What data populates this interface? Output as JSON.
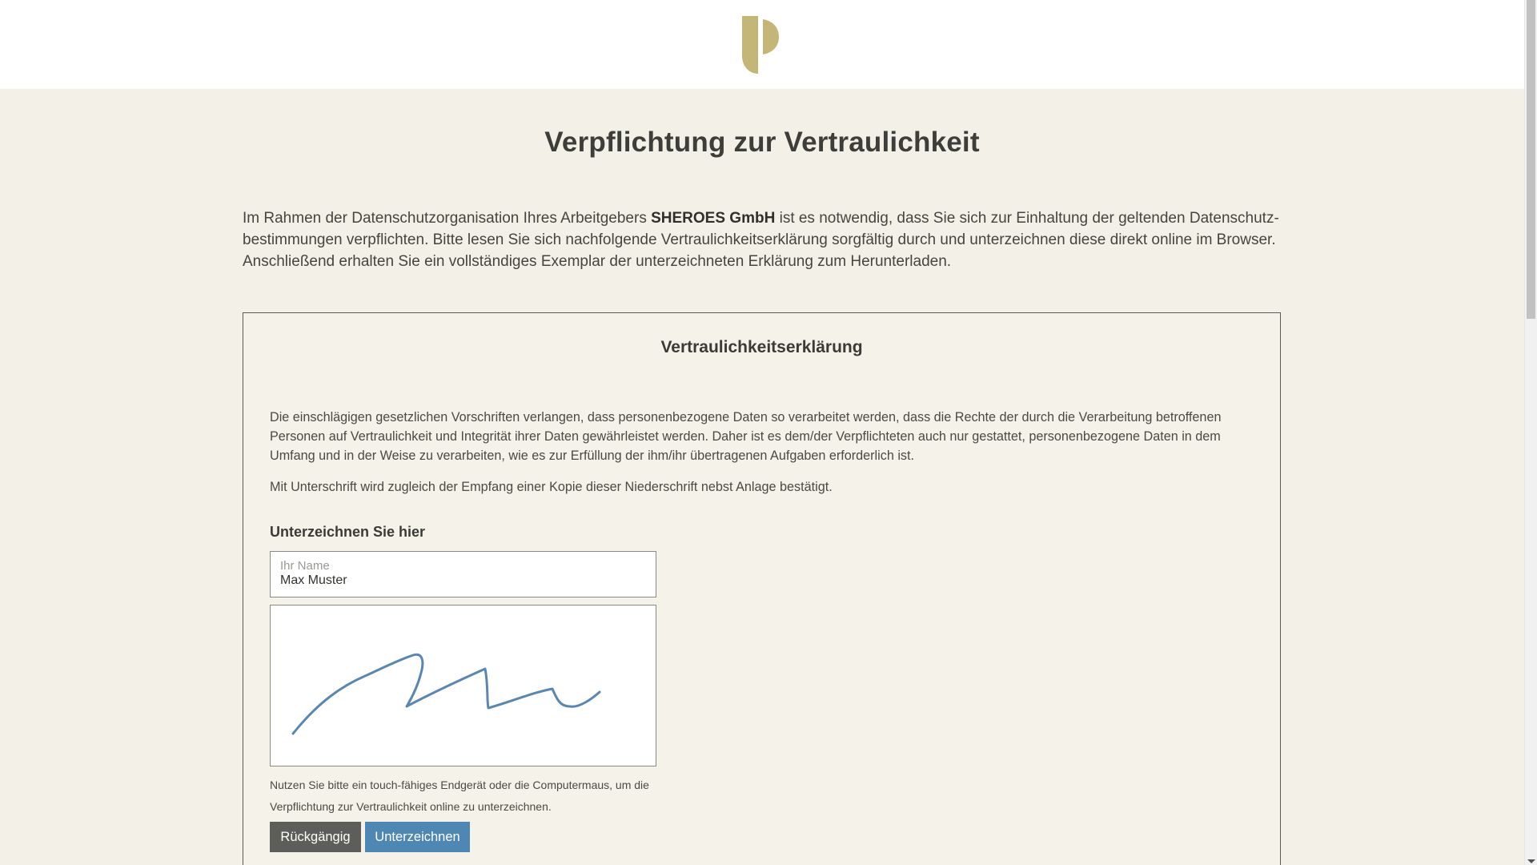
{
  "header": {
    "logo": "p-logo",
    "logo_color": "#c3b676"
  },
  "main": {
    "title": "Verpflichtung zur Vertraulichkeit",
    "intro_before": "Im Rahmen der Datenschutzorganisation Ihres Arbeitgebers ",
    "intro_company": "SHEROES GmbH",
    "intro_after": " ist es notwendig, dass Sie sich zur Einhaltung der geltenden Datenschutz-bestimmungen verpflichten. Bitte lesen Sie sich nachfolgende Vertraulichkeitserklärung sorgfältig durch und unterzeichnen diese direkt online im Browser. Anschließend erhalten Sie ein vollständiges Exemplar der unterzeichneten Erklärung zum Herunterladen."
  },
  "card": {
    "title": "Vertraulichkeitserklärung",
    "paragraph1": "Die einschlägigen gesetzlichen Vorschriften verlangen, dass personenbezogene Daten so verarbeitet werden, dass die Rechte der durch die Verarbeitung betroffenen Personen auf Vertraulichkeit und Integrität ihrer Daten gewährleistet werden. Daher ist es dem/der Verpflichteten auch nur gestattet, personenbezogene Daten in dem Umfang und in der Weise zu verarbeiten, wie es zur Erfüllung der ihm/ihr übertragenen Aufgaben erforderlich ist.",
    "paragraph2": "Mit Unterschrift wird zugleich der Empfang einer Kopie dieser Niederschrift nebst Anlage bestätigt."
  },
  "signature": {
    "heading": "Unterzeichnen Sie hier",
    "name_label": "Ihr Name",
    "name_value": "Max Muster",
    "stroke_color": "#5a87b0",
    "hint": "Nutzen Sie bitte ein touch-fähiges Endgerät oder die Computermaus, um die Verpflichtung zur Vertraulichkeit online zu unterzeichnen.",
    "undo_label": "Rückgängig",
    "sign_label": "Unterzeichnen"
  },
  "colors": {
    "background": "#f3f1e7",
    "undo_button": "#5d5d59",
    "sign_button": "#4f87b4"
  }
}
